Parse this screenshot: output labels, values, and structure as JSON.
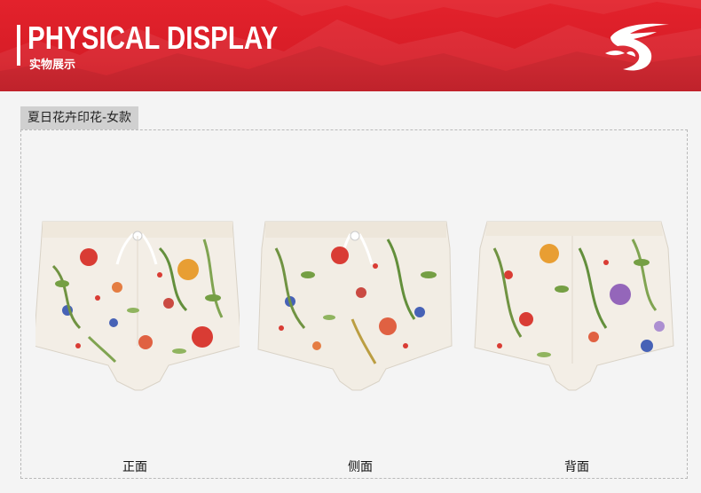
{
  "header": {
    "title": "PHYSICAL DISPLAY",
    "subtitle": "实物展示"
  },
  "section": {
    "label": "夏日花卉印花-女款"
  },
  "views": [
    {
      "caption": "正面",
      "image": "shorts-front-photo"
    },
    {
      "caption": "侧面",
      "image": "shorts-side-photo"
    },
    {
      "caption": "背面",
      "image": "shorts-back-photo"
    }
  ],
  "colors": {
    "banner": "#e3222c",
    "tag_background": "#d0d0d0",
    "page_background": "#f4f4f4"
  }
}
